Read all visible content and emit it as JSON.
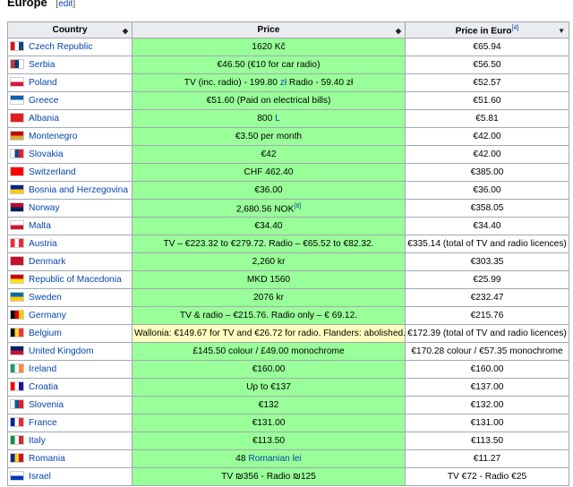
{
  "section": {
    "title": "Europe",
    "edit_open": "[",
    "edit_label": "edit",
    "edit_close": "]"
  },
  "headers": {
    "country": "Country",
    "price": "Price",
    "euro": "Price in Euro",
    "euro_ref": "[4]"
  },
  "rows": [
    {
      "country": "Czech Republic",
      "price": "1620 Kč",
      "euro": "€65.94",
      "flag": [
        "#d7141a",
        "#ffffff",
        "#11457e"
      ]
    },
    {
      "country": "Serbia",
      "price": "€46.50 (€10 for car radio)",
      "euro": "€56.50",
      "flag": [
        "#c6363c",
        "#0c4076",
        "#ffffff"
      ]
    },
    {
      "country": "Poland",
      "price_pre": "TV (inc. radio) - 199.80 ",
      "price_link": "zł",
      "price_post": " Radio - 59.40 zł",
      "euro": "€52.57",
      "flag": [
        "#ffffff",
        "#dc143c"
      ]
    },
    {
      "country": "Greece",
      "price": "€51.60 (Paid on electrical bills)",
      "euro": "€51.60",
      "flag": [
        "#0d5eaf",
        "#ffffff"
      ]
    },
    {
      "country": "Albania",
      "price_pre": "800 ",
      "price_link": "L",
      "price_post": "",
      "euro": "€5.81",
      "flag": [
        "#e41e20"
      ]
    },
    {
      "country": "Montenegro",
      "price": "€3.50 per month",
      "euro": "€42.00",
      "flag": [
        "#c40308",
        "#d4af37"
      ]
    },
    {
      "country": "Slovakia",
      "price": "€42",
      "euro": "€42.00",
      "flag": [
        "#ffffff",
        "#0b4ea2",
        "#ee1c25"
      ]
    },
    {
      "country": "Switzerland",
      "price": "CHF 462.40",
      "euro": "€385.00",
      "flag": [
        "#ff0000"
      ]
    },
    {
      "country": "Bosnia and Herzegovina",
      "price": "€36.00",
      "euro": "€36.00",
      "flag": [
        "#002395",
        "#fecb00"
      ]
    },
    {
      "country": "Norway",
      "price": "2,680.56 NOK",
      "price_ref": "[8]",
      "euro": "€358.05",
      "flag": [
        "#ba0c2f",
        "#00205b"
      ]
    },
    {
      "country": "Malta",
      "price": "€34.40",
      "euro": "€34.40",
      "flag": [
        "#ffffff",
        "#cf142b"
      ]
    },
    {
      "country": "Austria",
      "price": "TV – €223.32 to €279.72. Radio – €65.52 to €82.32.",
      "euro": "€335.14 (total of TV and radio licences)",
      "flag": [
        "#ed2939",
        "#ffffff",
        "#ed2939"
      ]
    },
    {
      "country": "Denmark",
      "price": "2,260 kr",
      "euro": "€303.35",
      "flag": [
        "#c8102e"
      ]
    },
    {
      "country": "Republic of Macedonia",
      "price": "MKD 1560",
      "euro": "€25.99",
      "flag": [
        "#d20000",
        "#ffe600"
      ]
    },
    {
      "country": "Sweden",
      "price": "2076 kr",
      "euro": "€232.47",
      "flag": [
        "#006aa7",
        "#fecc00"
      ]
    },
    {
      "country": "Germany",
      "price": "TV & radio – €215.76. Radio only – € 69.12.",
      "euro": "€215.76",
      "flag": [
        "#000000",
        "#dd0000",
        "#ffce00"
      ]
    },
    {
      "country": "Belgium",
      "price": "Wallonia: €149.67 for TV and €26.72 for radio. Flanders: abolished.",
      "euro": "€172.39 (total of TV and radio licences)",
      "flag": [
        "#000000",
        "#fdda24",
        "#ef3340"
      ],
      "highlight": "amber"
    },
    {
      "country": "United Kingdom",
      "price": "£145.50 colour / £49.00 monochrome",
      "euro": "€170.28 colour / €57.35 monochrome",
      "flag": [
        "#012169",
        "#c8102e"
      ]
    },
    {
      "country": "Ireland",
      "price": "€160.00",
      "euro": "€160.00",
      "flag": [
        "#169b62",
        "#ffffff",
        "#ff883e"
      ]
    },
    {
      "country": "Croatia",
      "price": "Up to €137",
      "euro": "€137.00",
      "flag": [
        "#ff0000",
        "#ffffff",
        "#171796"
      ]
    },
    {
      "country": "Slovenia",
      "price": "€132",
      "euro": "€132.00",
      "flag": [
        "#ffffff",
        "#005da4",
        "#ed1c24"
      ]
    },
    {
      "country": "France",
      "price": "€131.00",
      "euro": "€131.00",
      "flag": [
        "#002395",
        "#ffffff",
        "#ed2939"
      ]
    },
    {
      "country": "Italy",
      "price": "€113.50",
      "euro": "€113.50",
      "flag": [
        "#009246",
        "#ffffff",
        "#ce2b37"
      ]
    },
    {
      "country": "Romania",
      "price_pre": "48 ",
      "price_link": "Romanian lei",
      "price_post": "",
      "euro": "€11.27",
      "flag": [
        "#002b7f",
        "#fcd116",
        "#ce1126"
      ]
    },
    {
      "country": "Israel",
      "price": "TV ₪356 - Radio ₪125",
      "euro": "TV €72 - Radio €25",
      "flag": [
        "#ffffff",
        "#0038b8"
      ]
    }
  ]
}
